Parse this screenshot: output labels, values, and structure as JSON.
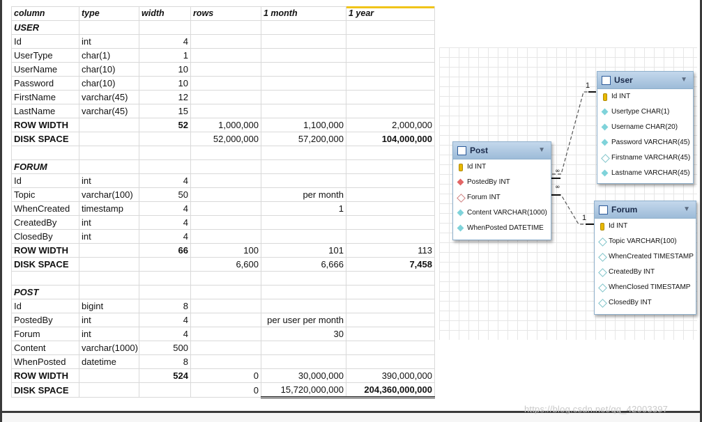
{
  "sheet": {
    "headers": [
      "column",
      "type",
      "width",
      "rows",
      "1 month",
      "1 year"
    ],
    "user": {
      "title": "USER",
      "rows": [
        [
          "Id",
          "int",
          "4"
        ],
        [
          "UserType",
          "char(1)",
          "1"
        ],
        [
          "UserName",
          "char(10)",
          "10"
        ],
        [
          "Password",
          "char(10)",
          "10"
        ],
        [
          "FirstName",
          "varchar(45)",
          "12"
        ],
        [
          "LastName",
          "varchar(45)",
          "15"
        ]
      ],
      "row_width": {
        "label": "ROW WIDTH",
        "width": "52",
        "rows": "1,000,000",
        "month": "1,100,000",
        "year": "2,000,000"
      },
      "disk_space": {
        "label": "DISK SPACE",
        "rows": "52,000,000",
        "month": "57,200,000",
        "year": "104,000,000"
      }
    },
    "forum": {
      "title": "FORUM",
      "rows": [
        [
          "Id",
          "int",
          "4",
          ""
        ],
        [
          "Topic",
          "varchar(100)",
          "50",
          "per month"
        ],
        [
          "WhenCreated",
          "timestamp",
          "4",
          "1"
        ],
        [
          "CreatedBy",
          "int",
          "4",
          ""
        ],
        [
          "ClosedBy",
          "int",
          "4",
          ""
        ]
      ],
      "row_width": {
        "label": "ROW WIDTH",
        "width": "66",
        "rows": "100",
        "month": "101",
        "year": "113"
      },
      "disk_space": {
        "label": "DISK SPACE",
        "rows": "6,600",
        "month": "6,666",
        "year": "7,458"
      }
    },
    "post": {
      "title": "POST",
      "rows": [
        [
          "Id",
          "bigint",
          "8",
          ""
        ],
        [
          "PostedBy",
          "int",
          "4",
          "per user per month"
        ],
        [
          "Forum",
          "int",
          "4",
          "30"
        ],
        [
          "Content",
          "varchar(1000)",
          "500",
          ""
        ],
        [
          "WhenPosted",
          "datetime",
          "8",
          ""
        ]
      ],
      "row_width": {
        "label": "ROW WIDTH",
        "width": "524",
        "rows": "0",
        "month": "30,000,000",
        "year": "390,000,000"
      },
      "disk_space": {
        "label": "DISK SPACE",
        "rows": "0",
        "month": "15,720,000,000",
        "year": "204,360,000,000"
      }
    }
  },
  "erd": {
    "user": {
      "name": "User",
      "columns": [
        {
          "icon": "pk",
          "text": "Id INT"
        },
        {
          "icon": "col",
          "text": "Usertype CHAR(1)"
        },
        {
          "icon": "col",
          "text": "Username CHAR(20)"
        },
        {
          "icon": "col",
          "text": "Password VARCHAR(45)"
        },
        {
          "icon": "nul2",
          "text": "Firstname VARCHAR(45)"
        },
        {
          "icon": "col",
          "text": "Lastname VARCHAR(45)"
        }
      ]
    },
    "post": {
      "name": "Post",
      "columns": [
        {
          "icon": "pk",
          "text": "Id INT"
        },
        {
          "icon": "fk",
          "text": "PostedBy INT"
        },
        {
          "icon": "nul",
          "text": "Forum INT"
        },
        {
          "icon": "col",
          "text": "Content VARCHAR(1000)"
        },
        {
          "icon": "col",
          "text": "WhenPosted DATETIME"
        }
      ]
    },
    "forum": {
      "name": "Forum",
      "columns": [
        {
          "icon": "pk",
          "text": "Id INT"
        },
        {
          "icon": "nul2",
          "text": "Topic VARCHAR(100)"
        },
        {
          "icon": "nul2",
          "text": "WhenCreated TIMESTAMP"
        },
        {
          "icon": "nul2",
          "text": "CreatedBy INT"
        },
        {
          "icon": "nul2",
          "text": "WhenClosed TIMESTAMP"
        },
        {
          "icon": "nul2",
          "text": "ClosedBy INT"
        }
      ]
    },
    "relations": {
      "one_label": "1",
      "many_label": "∞"
    }
  },
  "watermark": "https://blog.csdn.net/qq_42003397",
  "colors": {
    "header_fill": "#9dbbd8",
    "accent_line": "#f0c419"
  }
}
